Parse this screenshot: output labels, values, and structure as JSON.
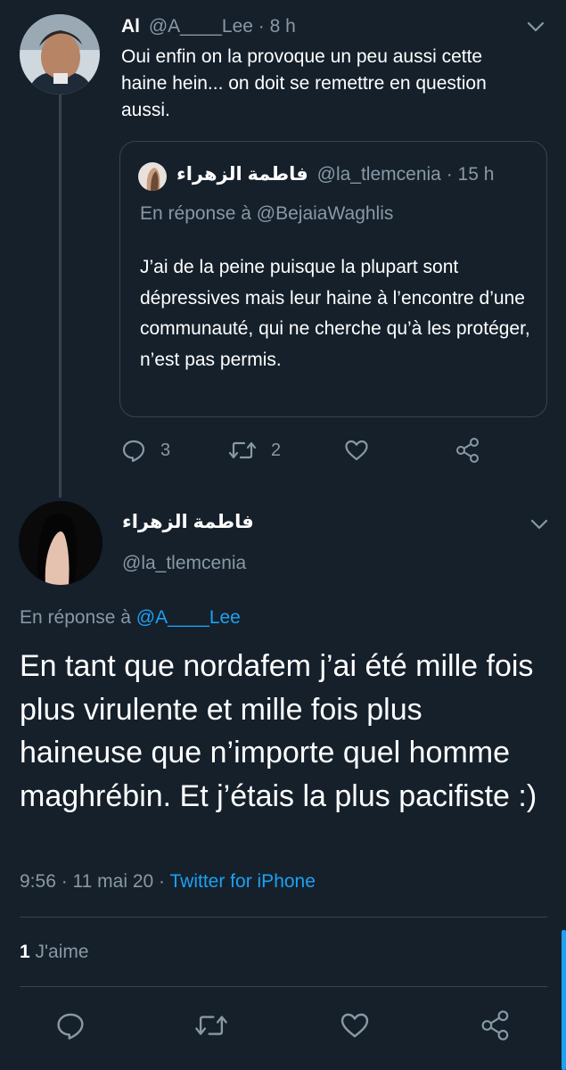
{
  "parent_tweet": {
    "author_name": "Al",
    "author_handle": "@A____Lee",
    "time": "8 h",
    "text": "Oui enfin on la provoque un peu aussi cette haine hein... on doit se remettre en question aussi.",
    "quoted": {
      "author_name": "فاطمة الزهراء",
      "author_handle": "@la_tlemcenia",
      "time": "15 h",
      "reply_prefix": "En réponse à",
      "reply_to": "@BejaiaWaghlis",
      "text": "J’ai de la peine puisque la plupart sont dépressives mais leur haine à l’encontre d’une communauté, qui ne cherche qu’à les protéger, n’est pas permis."
    },
    "reply_count": "3",
    "retweet_count": "2"
  },
  "main_tweet": {
    "author_name": "فاطمة الزهراء",
    "author_handle": "@la_tlemcenia",
    "reply_prefix": "En réponse à",
    "reply_to": "@A____Lee",
    "text": "En tant que nordafem j’ai été mille fois plus virulente et mille fois plus haineuse que n’importe quel homme maghrébin. Et j’étais la plus pacifiste :)",
    "timestamp": "9:56 · 11 mai 20 ·",
    "source": "Twitter for iPhone",
    "likes_count": "1",
    "likes_label": "J'aime"
  },
  "icons": {
    "reply": "reply-icon",
    "retweet": "retweet-icon",
    "like": "heart-icon",
    "share": "share-icon",
    "menu": "chevron-down-icon"
  },
  "colors": {
    "background": "#15202b",
    "muted": "#8899a6",
    "link": "#1da1f2",
    "border": "#38444d"
  }
}
